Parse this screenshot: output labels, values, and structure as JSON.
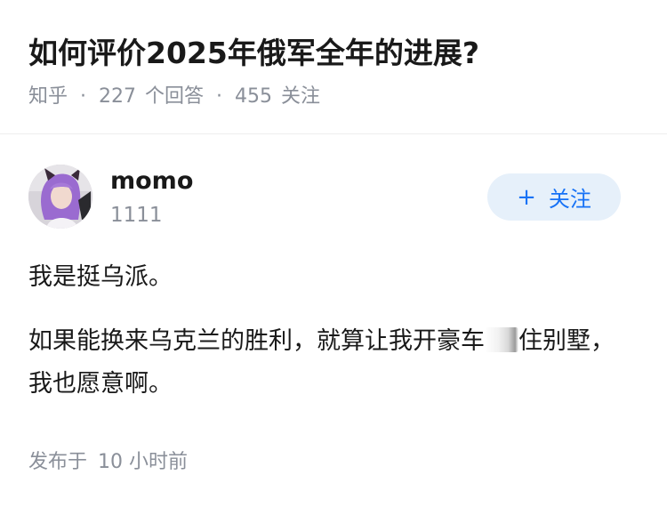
{
  "question": {
    "title": "如何评价2025年俄军全年的进展?",
    "source": "知乎",
    "separator": "·",
    "answers_count": "227",
    "answers_label": "个回答",
    "followers_count": "455",
    "followers_label": "关注"
  },
  "author": {
    "name": "momo",
    "bio": "1111",
    "follow_plus": "+",
    "follow_label": "关注"
  },
  "answer": {
    "paragraph1": "我是挺乌派。",
    "paragraph2_part1": "如果能换来乌克兰的胜利，就算让我开豪车",
    "paragraph2_part2": "住别墅，我也愿意啊。",
    "published_label": "发布于",
    "published_time": "10 小时前"
  },
  "colors": {
    "accent": "#1772f6",
    "follow_bg": "#e6f0fa",
    "meta_text": "#8a8f99"
  },
  "icons": {
    "avatar": "avatar-image"
  }
}
